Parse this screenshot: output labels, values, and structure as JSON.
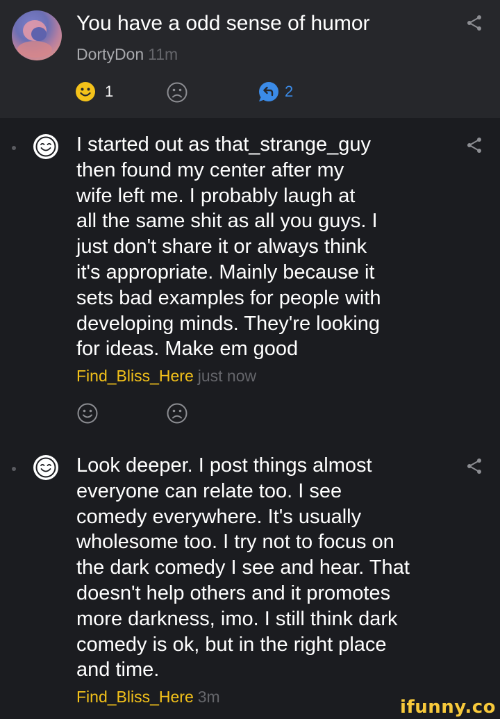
{
  "parent_comment": {
    "text": "You have a odd sense of humor",
    "username": "DortyDon",
    "time": "11m",
    "smile_count": "1",
    "reply_count": "2"
  },
  "replies": [
    {
      "lines": [
        "I started out as that_strange_guy",
        "then found my center after my",
        "wife left me. I probably laugh at",
        "all the same shit as all you guys. I",
        "just don't share it or always think",
        "it's appropriate. Mainly because it",
        "sets bad examples for people with",
        "developing minds. They're looking",
        "for ideas. Make em good"
      ],
      "username": "Find_Bliss_Here",
      "time": "just now"
    },
    {
      "lines": [
        "Look deeper. I post things almost",
        "everyone can relate too. I see",
        "comedy everywhere. It's usually",
        "wholesome too. I try not to focus on",
        "the dark comedy I see and hear. That",
        "doesn't help others and it promotes",
        "more darkness, imo. I still think dark",
        "comedy is ok, but in the right place",
        "and time."
      ],
      "username": "Find_Bliss_Here",
      "time": "3m"
    }
  ],
  "watermark": "ifunny.co",
  "colors": {
    "background": "#1b1c20",
    "parent_background": "#26272b",
    "username_reply": "#f4c21a",
    "reply_count": "#3b8be8",
    "smile_active": "#f4c21a"
  },
  "icons": [
    "avatar",
    "share-icon",
    "smile-icon",
    "frown-icon",
    "reply-icon",
    "commenter-avatar-icon"
  ]
}
